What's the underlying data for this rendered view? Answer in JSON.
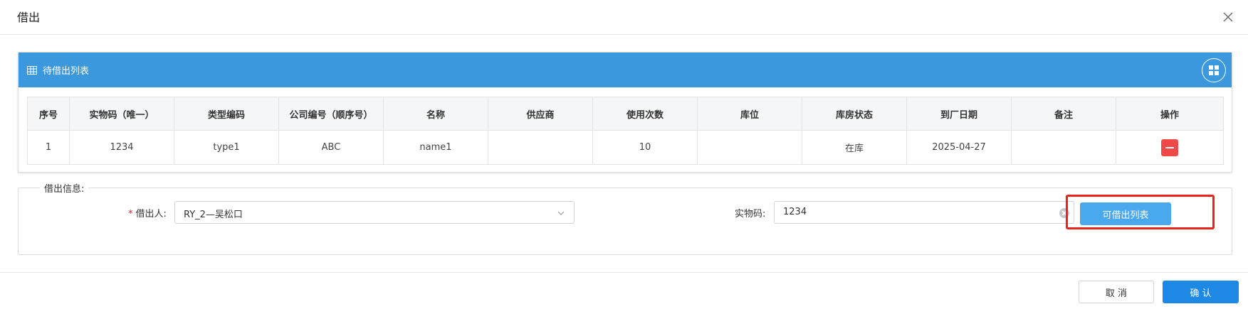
{
  "dialog": {
    "title": "借出",
    "close_icon": "close-icon"
  },
  "panel": {
    "title": "待借出列表",
    "title_icon": "table-icon",
    "tool_icon": "grid-layout-icon",
    "header_color": "#3b98dd"
  },
  "table": {
    "columns": [
      "序号",
      "实物码（唯一）",
      "类型编码",
      "公司编号（顺序号）",
      "名称",
      "供应商",
      "使用次数",
      "库位",
      "库房状态",
      "到厂日期",
      "备注",
      "操作"
    ],
    "rows": [
      {
        "index": "1",
        "code": "1234",
        "type_code": "type1",
        "company_no": "ABC",
        "name": "name1",
        "supplier": "",
        "use_count": "10",
        "location": "",
        "warehouse_status": "在库",
        "arrival_date": "2025-04-27",
        "remark": "",
        "action_icon": "minus-icon"
      }
    ]
  },
  "form": {
    "legend": "借出信息:",
    "borrower_required_mark": "*",
    "borrower_label": "借出人:",
    "borrower_value": "RY_2—吴松口",
    "code_label": "实物码:",
    "code_value": "1234",
    "available_list_button": "可借出列表"
  },
  "footer": {
    "cancel_label": "取 消",
    "confirm_label": "确 认"
  },
  "colors": {
    "primary": "#1e88e5",
    "danger": "#f04848",
    "highlight": "#e8231b"
  }
}
